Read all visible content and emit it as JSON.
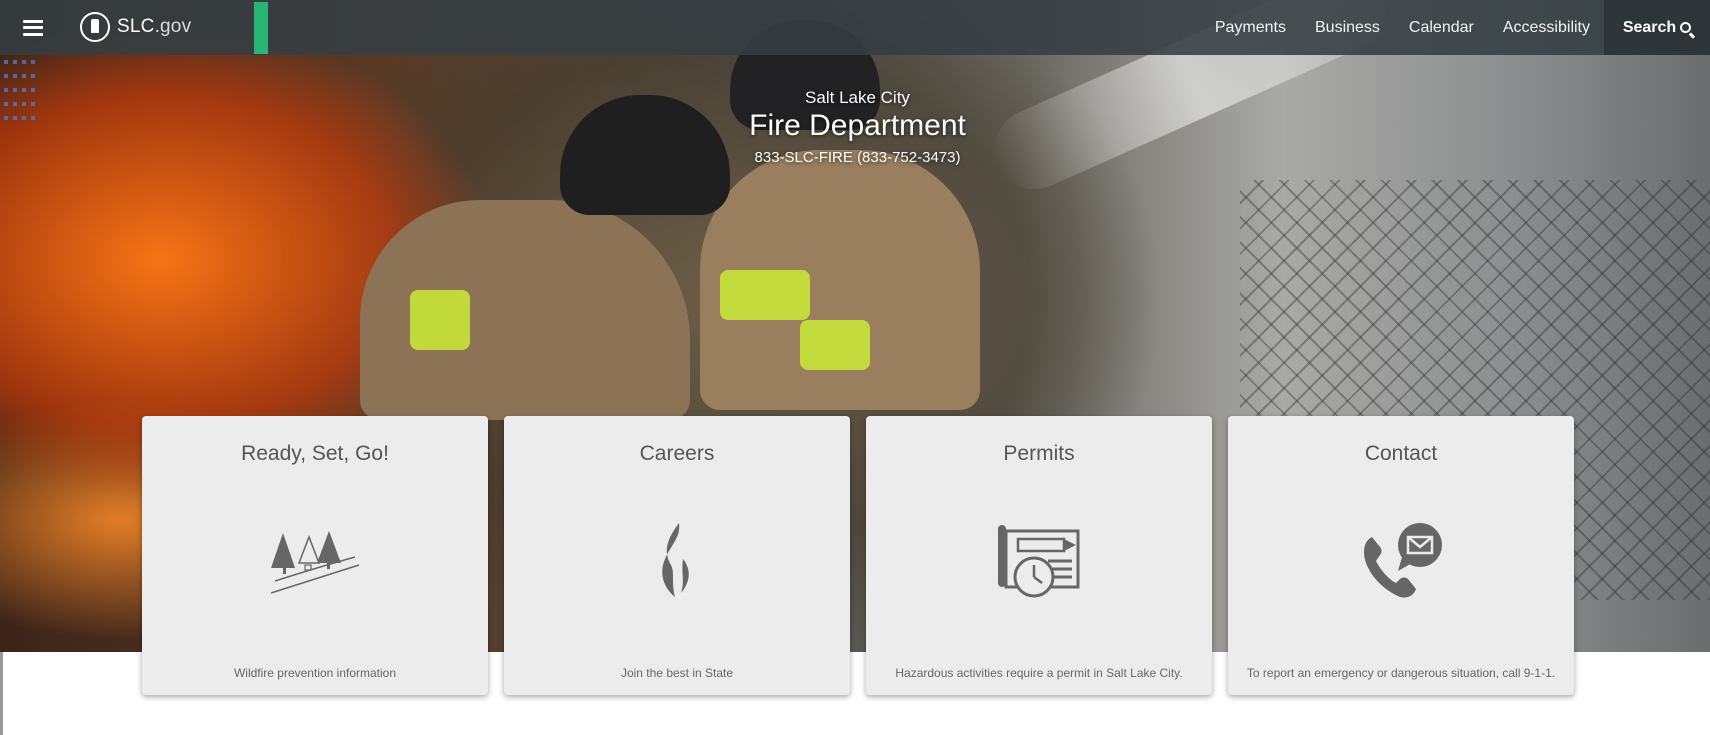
{
  "header": {
    "logo": {
      "main": "SLC",
      "suffix": ".gov"
    },
    "nav": [
      "Payments",
      "Business",
      "Calendar",
      "Accessibility"
    ],
    "search_label": "Search",
    "colors": {
      "bar": "#343e42",
      "accent": "#26b573"
    }
  },
  "hero": {
    "subtitle": "Salt Lake City",
    "title": "Fire Department",
    "phone": "833-SLC-FIRE (833-752-3473)"
  },
  "cards": [
    {
      "title": "Ready, Set, Go!",
      "icon": "wildfire-trees-icon",
      "description": "Wildfire prevention information"
    },
    {
      "title": "Careers",
      "icon": "flame-icon",
      "description": "Join the best in State"
    },
    {
      "title": "Permits",
      "icon": "permit-blueprint-icon",
      "description": "Hazardous activities require a permit in Salt Lake City."
    },
    {
      "title": "Contact",
      "icon": "phone-message-icon",
      "description": "To report an emergency or dangerous situation, call 9-1-1."
    }
  ]
}
